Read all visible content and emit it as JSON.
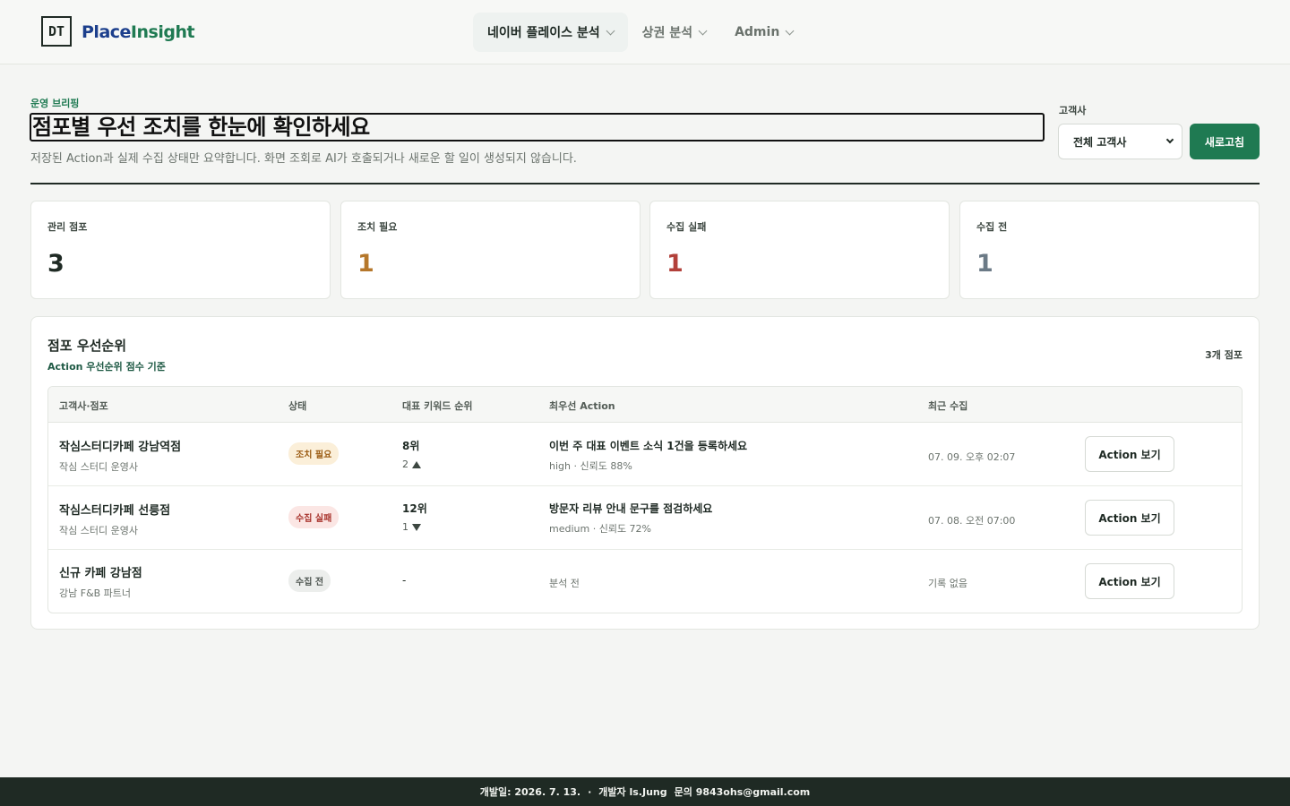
{
  "brand": {
    "logo_mark": "DT",
    "name_part1": "Place",
    "name_part2": "Insight"
  },
  "nav": [
    {
      "label": "네이버 플레이스 분석",
      "active": true
    },
    {
      "label": "상권 분석",
      "active": false
    },
    {
      "label": "Admin",
      "active": false
    }
  ],
  "header": {
    "eyebrow": "운영 브리핑",
    "title": "점포별 우선 조치를 한눈에 확인하세요",
    "subtitle": "저장된 Action과 실제 수집 상태만 요약합니다. 화면 조회로 AI가 호출되거나 새로운 할 일이 생성되지 않습니다."
  },
  "filter": {
    "label": "고객사",
    "selected": "전체 고객사",
    "refresh_label": "새로고침"
  },
  "stats": [
    {
      "label": "관리 점포",
      "value": "3",
      "color": "#1f2a24"
    },
    {
      "label": "조치 필요",
      "value": "1",
      "color": "#b5772b"
    },
    {
      "label": "수집 실패",
      "value": "1",
      "color": "#b2403a"
    },
    {
      "label": "수집 전",
      "value": "1",
      "color": "#6b7a86"
    }
  ],
  "priority": {
    "title": "점포 우선순위",
    "subtitle": "Action 우선순위 점수 기준",
    "count": "3개 점포",
    "columns": [
      "고객사·점포",
      "상태",
      "대표 키워드 순위",
      "최우선 Action",
      "최근 수집"
    ],
    "rows": [
      {
        "store": "작심스터디카페 강남역점",
        "client": "작심 스터디 운영사",
        "status": "조치 필요",
        "status_bg": "#fbefd9",
        "status_fg": "#9a5b12",
        "rank": "8위",
        "rank_delta": "2",
        "rank_dir": "up",
        "action": "이번 주 대표 이벤트 소식 1건을 등록하세요",
        "action_meta": "high · 신뢰도 88%",
        "last_collected": "07. 09. 오후 02:07",
        "button": "Action 보기"
      },
      {
        "store": "작심스터디카페 선릉점",
        "client": "작심 스터디 운영사",
        "status": "수집 실패",
        "status_bg": "#fbe6e4",
        "status_fg": "#a8332c",
        "rank": "12위",
        "rank_delta": "1",
        "rank_dir": "down",
        "action": "방문자 리뷰 안내 문구를 점검하세요",
        "action_meta": "medium · 신뢰도 72%",
        "last_collected": "07. 08. 오전 07:00",
        "button": "Action 보기"
      },
      {
        "store": "신규 카페 강남점",
        "client": "강남 F&B 파트너",
        "status": "수집 전",
        "status_bg": "#eceeec",
        "status_fg": "#4d5550",
        "rank": "-",
        "rank_delta": "",
        "rank_dir": "none",
        "action": "",
        "action_meta": "분석 전",
        "last_collected": "기록 없음",
        "button": "Action 보기"
      }
    ]
  },
  "footer": {
    "dev_date": "개발일: 2026. 7. 13.",
    "separator": "·",
    "developer": "개발자 ls.Jung",
    "contact": "문의 9843ohs@gmail.com"
  }
}
